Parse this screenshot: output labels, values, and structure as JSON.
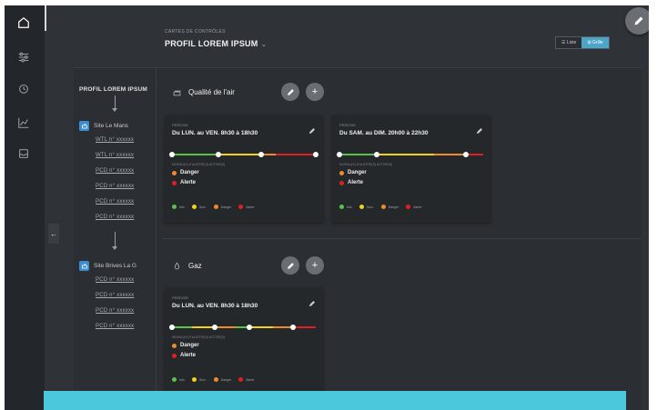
{
  "header": {
    "subtitle": "CARTES DE CONTRÔLES",
    "title": "PROFIL LOREM IPSUM",
    "view_toggle": {
      "list_label": "☰ Liste",
      "grid_label": "⊞ Grille",
      "active": "grid"
    }
  },
  "rail": {
    "icons": [
      "home-icon",
      "sliders-icon",
      "alarm-icon",
      "chart-icon",
      "inbox-icon"
    ]
  },
  "tree": {
    "title": "PROFIL LOREM IPSUM",
    "sites": [
      {
        "name": "Site Le Mans",
        "items": [
          "WTL n° xxxxxx",
          "WTL n° xxxxxx",
          "PCD n° xxxxxx",
          "PCD n° xxxxxx",
          "PCD n° xxxxxx",
          "PCD n° xxxxxx"
        ]
      },
      {
        "name": "Site Brives La G",
        "items": [
          "PCD n° xxxxxx",
          "PCD n° xxxxxx",
          "PCD n° xxxxxx",
          "PCD n° xxxxxx"
        ]
      }
    ]
  },
  "sections": [
    {
      "title": "Qualité de l'air",
      "icon": "air-quality-icon",
      "cards": [
        {
          "label": "PÉRIODE",
          "title": "Du LUN. au VEN. 8h30 à 18h30",
          "sub": "NIVEAU(X) D'ALERTE(S) ACTIVÉ(S)",
          "alerts": [
            {
              "label": "Danger",
              "color": "#f08a2a"
            },
            {
              "label": "Alerte",
              "color": "#e02020"
            }
          ]
        },
        {
          "label": "PÉRIODE",
          "title": "Du SAM. au DIM. 20h00 à 22h30",
          "sub": "NIVEAU(X) D'ALERTE(S) ACTIVÉ(S)",
          "alerts": [
            {
              "label": "Danger",
              "color": "#f08a2a"
            },
            {
              "label": "Alerte",
              "color": "#e02020"
            }
          ]
        }
      ]
    },
    {
      "title": "Gaz",
      "icon": "gas-icon",
      "cards": [
        {
          "label": "PÉRIODE",
          "title": "Du LUN. au VEN. 8h30 à 18h30",
          "sub": "NIVEAU(X) D'ALERTE(S) ACTIVÉ(S)",
          "alerts": [
            {
              "label": "Danger",
              "color": "#f08a2a"
            },
            {
              "label": "Alerte",
              "color": "#e02020"
            }
          ]
        }
      ]
    }
  ],
  "legend": [
    {
      "label": "Info",
      "color": "#5cc14a"
    },
    {
      "label": "Surv.",
      "color": "#f2d21a"
    },
    {
      "label": "Danger",
      "color": "#f08a2a"
    },
    {
      "label": "Alerte",
      "color": "#e02020"
    }
  ],
  "colors": {
    "accent": "#4aa5c8",
    "bottom_bar": "#4cc8dc",
    "site_icon": "#3b8fd0"
  }
}
